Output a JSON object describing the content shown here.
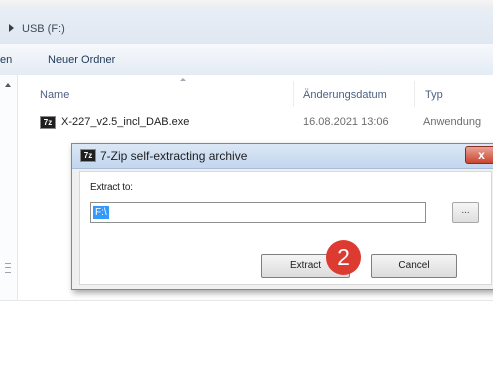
{
  "explorer": {
    "address": {
      "path": "USB (F:)"
    },
    "toolbar": {
      "left_cut": "en",
      "new_folder": "Neuer Ordner"
    },
    "columns": {
      "name": "Name",
      "date": "Änderungsdatum",
      "type": "Typ"
    },
    "file": {
      "icon": "7z",
      "name": "X-227_v2.5_incl_DAB.exe",
      "date": "16.08.2021 13:06",
      "type": "Anwendung"
    }
  },
  "dialog": {
    "icon": "7z",
    "title": "7-Zip self-extracting archive",
    "close_label": "x",
    "extract_to_label": "Extract to:",
    "path_value": "F:\\",
    "browse_label": "...",
    "extract_button": "Extract",
    "cancel_button": "Cancel"
  },
  "annotation": {
    "step": "2",
    "color": "#dd3a31"
  }
}
